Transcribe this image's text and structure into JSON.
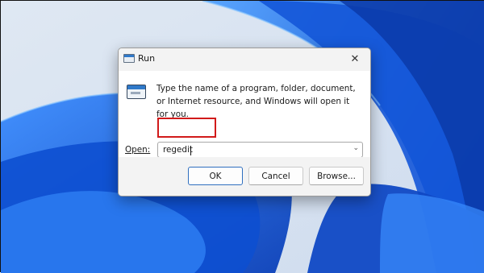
{
  "window": {
    "title": "Run",
    "close_glyph": "✕"
  },
  "dialog": {
    "description": "Type the name of a program, folder, document, or Internet resource, and Windows will open it for you.",
    "open_label": "Open:",
    "open_value": "regedit"
  },
  "buttons": {
    "ok": "OK",
    "cancel": "Cancel",
    "browse": "Browse..."
  },
  "colors": {
    "accent": "#2f6fbf",
    "highlight": "#d11a1a",
    "wallpaper": "#1a5ee0"
  },
  "icons": {
    "app": "run-app-icon",
    "dropdown": "chevron-down-icon",
    "close": "close-icon"
  }
}
